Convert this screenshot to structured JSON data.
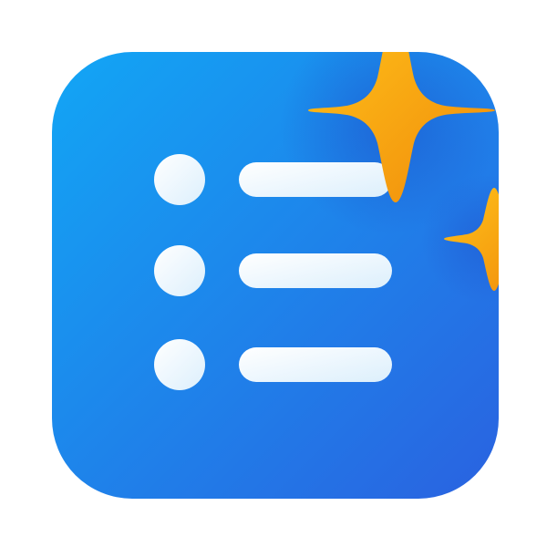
{
  "icon": {
    "name": "checklist-sparkle-app-icon",
    "glyphs": [
      "list-icon",
      "sparkle-icon"
    ],
    "list_rows": 3
  },
  "colors": {
    "tile_start": "#12A6F5",
    "tile_end": "#2A62E0",
    "list_start": "#FFFFFF",
    "list_end": "#DCEFFC",
    "sparkle_start": "#FFC21A",
    "sparkle_end": "#F08A0A"
  }
}
